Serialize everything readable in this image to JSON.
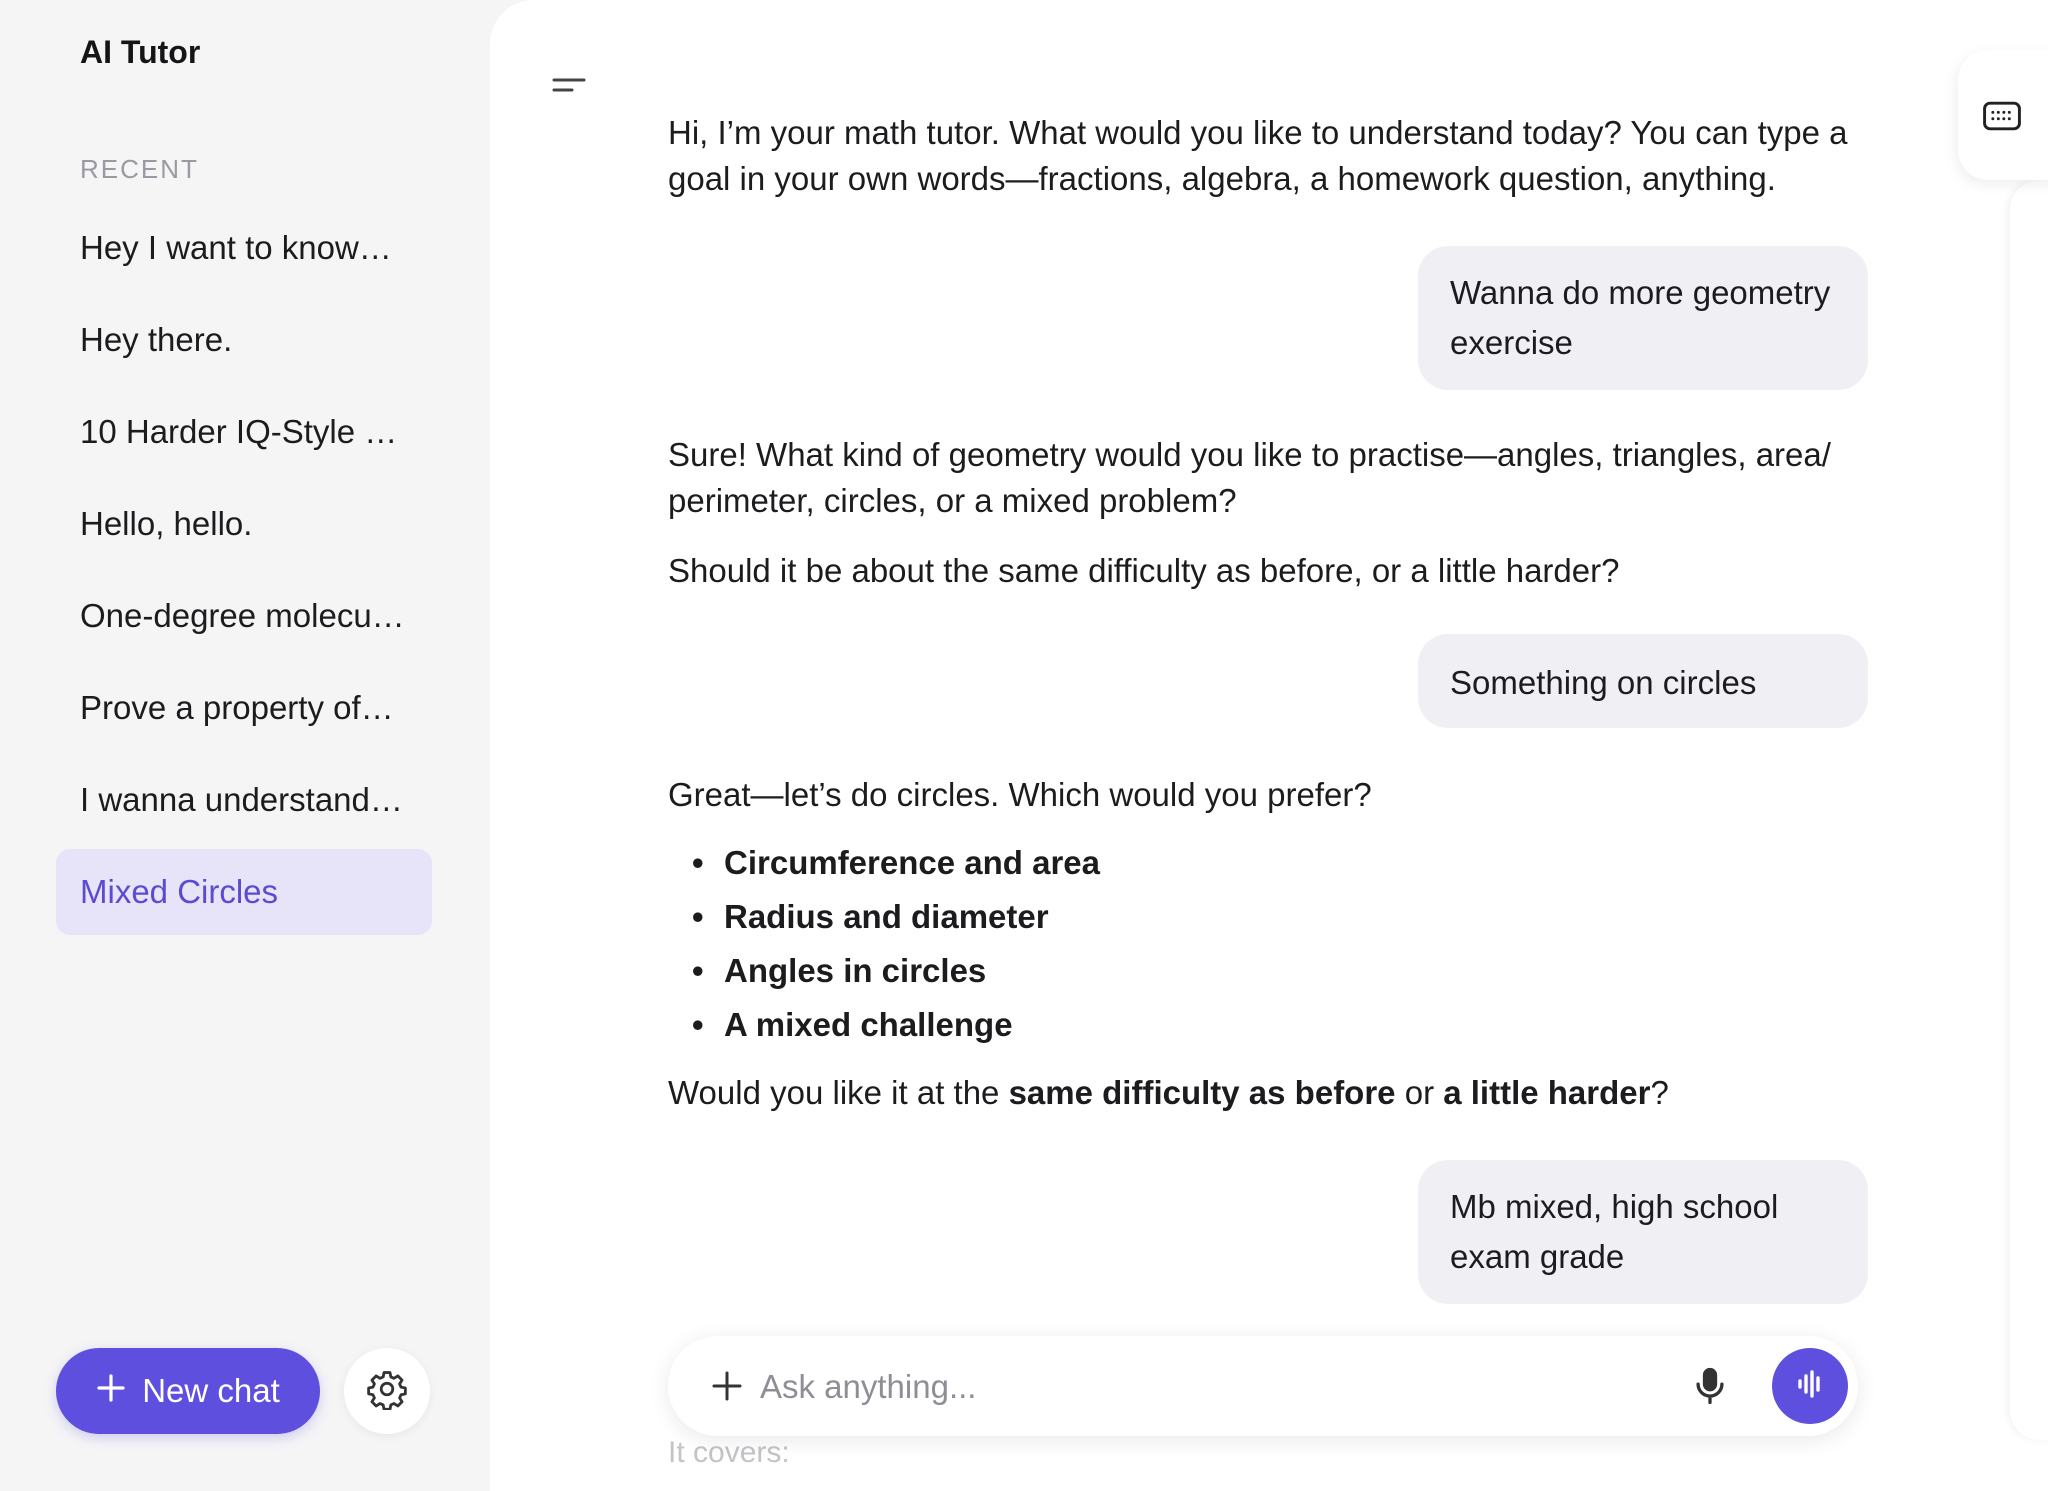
{
  "sidebar": {
    "app_title": "AI Tutor",
    "recent_label": "RECENT",
    "chats": [
      {
        "label": "Hey I want to know…",
        "active": false
      },
      {
        "label": "Hey there.",
        "active": false
      },
      {
        "label": "10 Harder IQ-Style C…",
        "active": false
      },
      {
        "label": "Hello, hello.",
        "active": false
      },
      {
        "label": "One-degree molecul…",
        "active": false
      },
      {
        "label": "Prove a property of…",
        "active": false
      },
      {
        "label": "I wanna understand…",
        "active": false
      },
      {
        "label": "Mixed Circles",
        "active": true
      }
    ],
    "new_chat_label": "New chat",
    "icons": {
      "new_chat": "plus-icon",
      "settings": "gear-icon"
    }
  },
  "conversation": {
    "msg1": "Hi, I’m your math tutor. What would you like to understand today? You can type a goal in your own words—fractions, algebra, a homework question, anything.",
    "user1": "Wanna do more geometry exercise",
    "msg2_p1": "Sure! What kind of geometry would you like to practise—angles, triangles, area/ perimeter, circles, or a mixed problem?",
    "msg2_p2": "Should it be about the same difficulty as before, or a little harder?",
    "user2": "Something on circles",
    "msg3_intro": "Great—let’s do circles. Which would you prefer?",
    "msg3_options": [
      "Circumference and area",
      "Radius and diameter",
      "Angles in circles",
      "A mixed challenge"
    ],
    "msg3_outro": {
      "pre": "Would you like it at the ",
      "bold1": "same difficulty as before",
      "mid": " or ",
      "bold2": "a little harder",
      "post": "?"
    },
    "user3": "Mb mixed, high school exam grade",
    "faded_next": "It covers:"
  },
  "composer": {
    "placeholder": "Ask anything...",
    "icons": {
      "attach": "plus-icon",
      "mic": "microphone-icon",
      "voice": "voice-waveform-icon"
    }
  },
  "header": {
    "icons": {
      "menu": "sidebar-toggle-icon",
      "keyboard": "keyboard-icon"
    }
  },
  "colors": {
    "accent": "#5f4fde",
    "active_bg": "#e7e3f8",
    "user_bubble": "#f0eff4"
  }
}
